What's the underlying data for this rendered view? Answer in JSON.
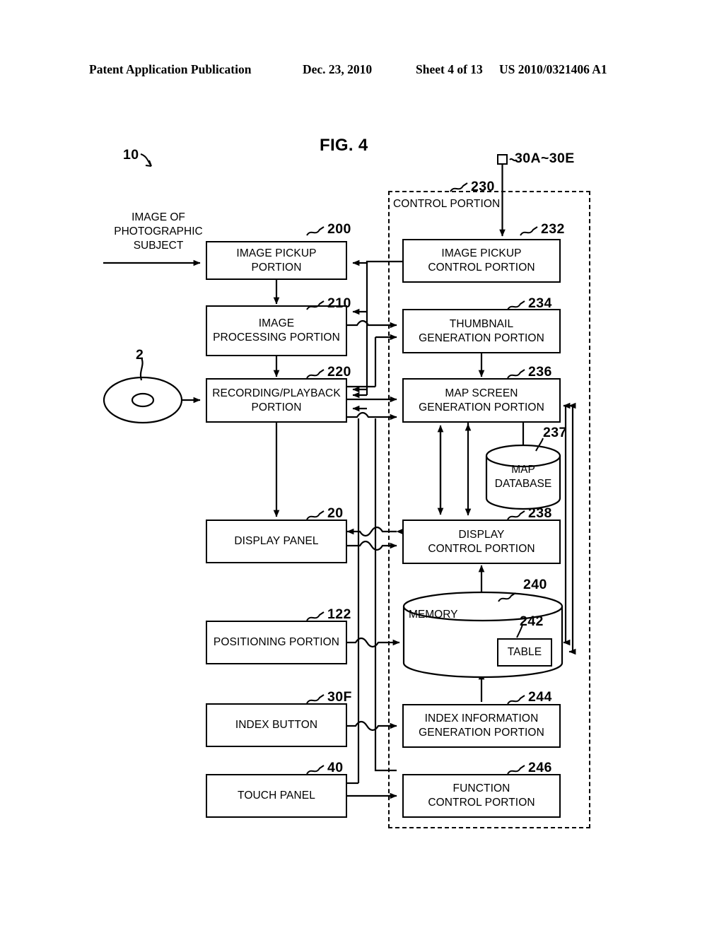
{
  "header": {
    "publication": "Patent Application Publication",
    "date": "Dec. 23, 2010",
    "sheet": "Sheet 4 of 13",
    "docnum": "US 2010/0321406 A1"
  },
  "figure": {
    "title": "FIG. 4",
    "system_ref": "10",
    "external_buttons_ref": "30A~30E"
  },
  "control_region": {
    "label": "CONTROL PORTION",
    "ref": "230"
  },
  "free_text": {
    "input_signal": "IMAGE OF\nPHOTOGRAPHIC\nSUBJECT",
    "media_ref": "2"
  },
  "blocks": [
    {
      "id": "image-pickup-portion",
      "label": "IMAGE PICKUP PORTION",
      "ref": "200"
    },
    {
      "id": "image-processing-portion",
      "label": "IMAGE\nPROCESSING PORTION",
      "ref": "210"
    },
    {
      "id": "recording-playback-portion",
      "label": "RECORDING/PLAYBACK\nPORTION",
      "ref": "220"
    },
    {
      "id": "display-panel",
      "label": "DISPLAY PANEL",
      "ref": "20"
    },
    {
      "id": "positioning-portion",
      "label": "POSITIONING PORTION",
      "ref": "122"
    },
    {
      "id": "index-button",
      "label": "INDEX BUTTON",
      "ref": "30F"
    },
    {
      "id": "touch-panel",
      "label": "TOUCH PANEL",
      "ref": "40"
    },
    {
      "id": "image-pickup-control-portion",
      "label": "IMAGE PICKUP\nCONTROL PORTION",
      "ref": "232"
    },
    {
      "id": "thumbnail-generation-portion",
      "label": "THUMBNAIL\nGENERATION PORTION",
      "ref": "234"
    },
    {
      "id": "map-screen-generation-portion",
      "label": "MAP SCREEN\nGENERATION PORTION",
      "ref": "236"
    },
    {
      "id": "map-database",
      "label": "MAP\nDATABASE",
      "ref": "237"
    },
    {
      "id": "display-control-portion",
      "label": "DISPLAY\nCONTROL PORTION",
      "ref": "238"
    },
    {
      "id": "memory",
      "label": "MEMORY",
      "ref": "240"
    },
    {
      "id": "table",
      "label": "TABLE",
      "ref": "242"
    },
    {
      "id": "index-information-generation-portion",
      "label": "INDEX INFORMATION\nGENERATION PORTION",
      "ref": "244"
    },
    {
      "id": "function-control-portion",
      "label": "FUNCTION\nCONTROL PORTION",
      "ref": "246"
    }
  ]
}
